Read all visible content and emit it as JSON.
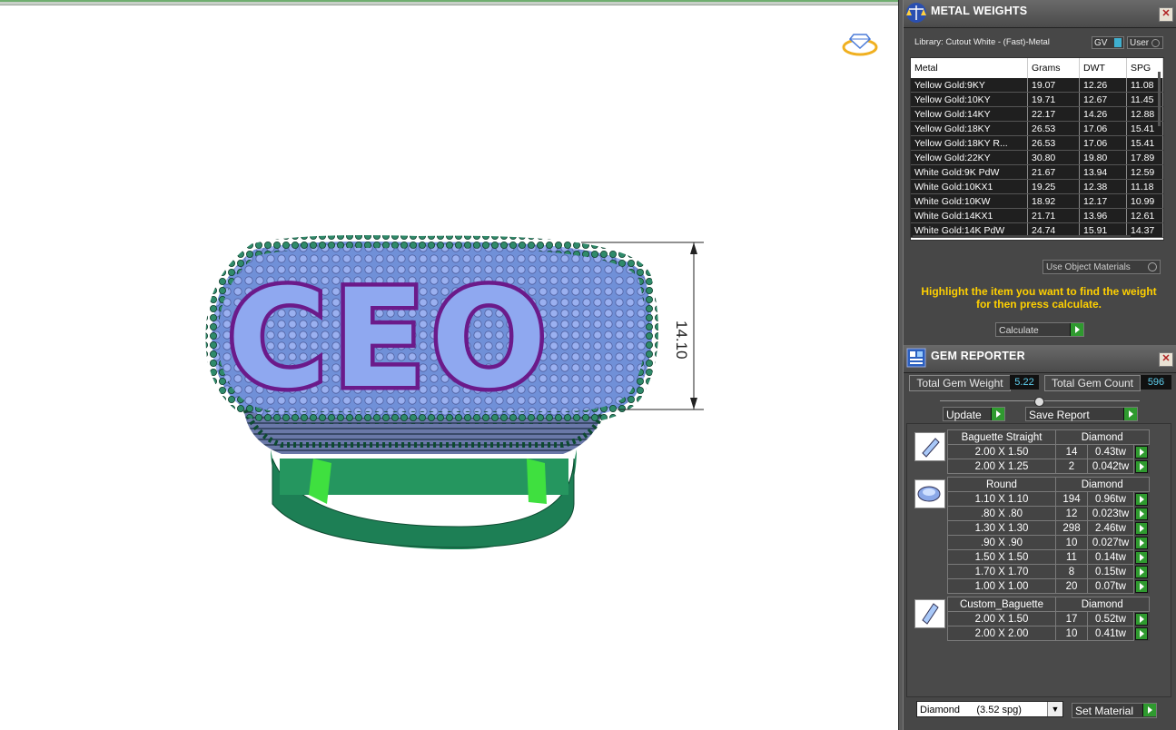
{
  "viewport": {
    "dimension_label": "14.10",
    "ring_text": "CEO"
  },
  "metal_weights": {
    "title": "METAL WEIGHTS",
    "library_label": "Library: Cutout White - (Fast)-Metal",
    "toggle_gv": "GV",
    "toggle_user": "User",
    "columns": [
      "Metal",
      "Grams",
      "DWT",
      "SPG"
    ],
    "rows": [
      [
        "Yellow Gold:9KY",
        "19.07",
        "12.26",
        "11.08"
      ],
      [
        "Yellow Gold:10KY",
        "19.71",
        "12.67",
        "11.45"
      ],
      [
        "Yellow Gold:14KY",
        "22.17",
        "14.26",
        "12.88"
      ],
      [
        "Yellow Gold:18KY",
        "26.53",
        "17.06",
        "15.41"
      ],
      [
        "Yellow Gold:18KY R...",
        "26.53",
        "17.06",
        "15.41"
      ],
      [
        "Yellow Gold:22KY",
        "30.80",
        "19.80",
        "17.89"
      ],
      [
        "White Gold:9K PdW",
        "21.67",
        "13.94",
        "12.59"
      ],
      [
        "White Gold:10KX1",
        "19.25",
        "12.38",
        "11.18"
      ],
      [
        "White Gold:10KW",
        "18.92",
        "12.17",
        "10.99"
      ],
      [
        "White Gold:14KX1",
        "21.71",
        "13.96",
        "12.61"
      ],
      [
        "White Gold:14K PdW",
        "24.74",
        "15.91",
        "14.37"
      ]
    ],
    "use_object_materials": "Use Object Materials",
    "hint": "Highlight the item you want to find the weight for then press calculate.",
    "calculate_label": "Calculate"
  },
  "gem_reporter": {
    "title": "GEM REPORTER",
    "total_weight_label": "Total Gem Weight",
    "total_weight_value": "5.22",
    "total_count_label": "Total Gem Count",
    "total_count_value": "596",
    "update_label": "Update",
    "save_report_label": "Save Report",
    "groups": [
      {
        "shape": "Baguette Straight",
        "material": "Diamond",
        "rows": [
          [
            "2.00 X 1.50",
            "14",
            "0.43tw"
          ],
          [
            "2.00 X 1.25",
            "2",
            "0.042tw"
          ]
        ]
      },
      {
        "shape": "Round",
        "material": "Diamond",
        "rows": [
          [
            "1.10 X 1.10",
            "194",
            "0.96tw"
          ],
          [
            ".80 X .80",
            "12",
            "0.023tw"
          ],
          [
            "1.30 X 1.30",
            "298",
            "2.46tw"
          ],
          [
            ".90 X .90",
            "10",
            "0.027tw"
          ],
          [
            "1.50 X 1.50",
            "11",
            "0.14tw"
          ],
          [
            "1.70 X 1.70",
            "8",
            "0.15tw"
          ],
          [
            "1.00 X 1.00",
            "20",
            "0.07tw"
          ]
        ]
      },
      {
        "shape": "Custom_Baguette",
        "material": "Diamond",
        "rows": [
          [
            "2.00 X 1.50",
            "17",
            "0.52tw"
          ],
          [
            "2.00 X 2.00",
            "10",
            "0.41tw"
          ]
        ]
      }
    ],
    "material_select": "Diamond      (3.52 spg)",
    "set_material_label": "Set Material"
  }
}
